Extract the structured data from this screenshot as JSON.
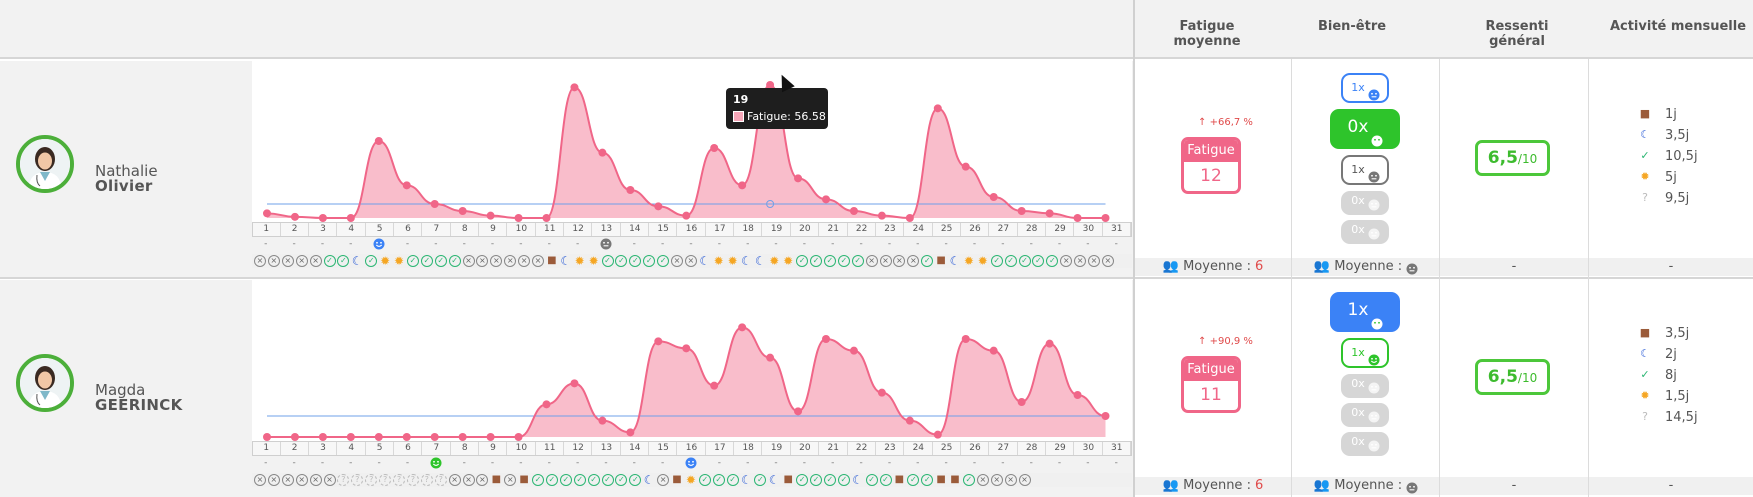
{
  "columns": [
    "Fatigue moyenne",
    "Bien-être",
    "Ressenti général",
    "Activité mensuelle"
  ],
  "days": [
    "1",
    "2",
    "3",
    "4",
    "5",
    "6",
    "7",
    "8",
    "9",
    "10",
    "11",
    "12",
    "13",
    "14",
    "15",
    "16",
    "17",
    "18",
    "19",
    "20",
    "21",
    "22",
    "23",
    "24",
    "25",
    "26",
    "27",
    "28",
    "29",
    "30",
    "31"
  ],
  "tooltip": {
    "title": "19",
    "label": "Fatigue: 56.58"
  },
  "colors": {
    "fatigue": "#f06688",
    "fill": "#f7a7b9",
    "baseline": "#6fa0e8",
    "good": "#4cc73a",
    "blue": "#3b82f6"
  },
  "rows": [
    {
      "first_name": "Nathalie",
      "last_name": "Olivier",
      "avatar_icon": "doctor-avatar-icon",
      "fatigue": {
        "delta": "↑ +66,7 %",
        "label": "Fatigue",
        "value": "12"
      },
      "wellbeing": [
        {
          "text": "1x",
          "style": "outline-blue",
          "face": "neutral"
        },
        {
          "text": "0x",
          "style": "solid-green",
          "face": "happy"
        },
        {
          "text": "1x",
          "style": "outline-grey",
          "face": "neutral"
        },
        {
          "text": "0x",
          "style": "light-grey",
          "face": "neutral"
        },
        {
          "text": "0x",
          "style": "light-grey",
          "face": "neutral"
        }
      ],
      "score": {
        "value": "6,5",
        "unit": "/10"
      },
      "activity": [
        {
          "icon": "briefcase-icon",
          "value": "1j"
        },
        {
          "icon": "moon-icon",
          "value": "3,5j"
        },
        {
          "icon": "check-icon",
          "value": "10,5j"
        },
        {
          "icon": "sun-icon",
          "value": "5j"
        },
        {
          "icon": "question-icon",
          "value": "9,5j"
        }
      ],
      "footer": {
        "fatigue": "Moyenne :",
        "fatigue_value": "6",
        "wellbeing": "Moyenne :",
        "ressenti": "-",
        "activite": "-"
      },
      "chart_data": {
        "type": "area",
        "series": [
          {
            "values": [
              2,
              0.5,
              0,
              0,
              33,
              14,
              6,
              3,
              1,
              0,
              0,
              56,
              28,
              12,
              5,
              1,
              30,
              14,
              57,
              17,
              8,
              3,
              1,
              0,
              47,
              22,
              9,
              3,
              2,
              0,
              0
            ]
          }
        ],
        "baseline": 6,
        "ylim": [
          0,
          60
        ]
      },
      "dash_marks": {
        "5": "face-blue",
        "13": "face-grey"
      },
      "day_icons": "xxxxxccmcssccccxxxxxxbmsscccccxxmssmmsscccccxxxxcbmsscccccxxxx"
    },
    {
      "first_name": "Magda",
      "last_name": "GEERINCK",
      "avatar_icon": "doctor-avatar-icon",
      "fatigue": {
        "delta": "↑ +90,9 %",
        "label": "Fatigue",
        "value": "11"
      },
      "wellbeing": [
        {
          "text": "1x",
          "style": "solid-blue",
          "face": "happy"
        },
        {
          "text": "1x",
          "style": "outline-green",
          "face": "happy"
        },
        {
          "text": "0x",
          "style": "light-grey",
          "face": "neutral"
        },
        {
          "text": "0x",
          "style": "light-grey",
          "face": "neutral"
        },
        {
          "text": "0x",
          "style": "light-grey",
          "face": "neutral"
        }
      ],
      "score": {
        "value": "6,5",
        "unit": "/10"
      },
      "activity": [
        {
          "icon": "briefcase-icon",
          "value": "3,5j"
        },
        {
          "icon": "moon-icon",
          "value": "2j"
        },
        {
          "icon": "check-icon",
          "value": "8j"
        },
        {
          "icon": "sun-icon",
          "value": "1,5j"
        },
        {
          "icon": "question-icon",
          "value": "14,5j"
        }
      ],
      "footer": {
        "fatigue": "Moyenne :",
        "fatigue_value": "6",
        "wellbeing": "Moyenne :",
        "ressenti": "-",
        "activite": "-"
      },
      "chart_data": {
        "type": "area",
        "series": [
          {
            "values": [
              0,
              0,
              0,
              0,
              0,
              0,
              0,
              0,
              0,
              0,
              14,
              23,
              7,
              2,
              41,
              38,
              22,
              47,
              34,
              11,
              42,
              37,
              19,
              7,
              1,
              42,
              37,
              15,
              40,
              18,
              9
            ]
          }
        ],
        "baseline": 9,
        "ylim": [
          0,
          60
        ]
      },
      "dash_marks": {
        "7": "face-green",
        "16": "face-blue"
      },
      "day_icons": "xxxxxxooooooooxxxbxbccccccccmxbscccmcmbccccmccbccbbcxxxx"
    }
  ]
}
